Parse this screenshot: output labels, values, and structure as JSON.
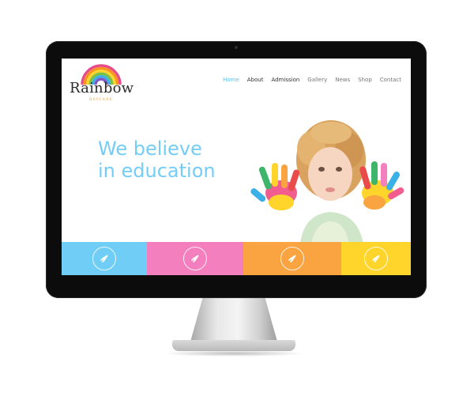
{
  "site": {
    "brand": "Rainbow",
    "brand_sub": "DAYCARE",
    "nav": [
      "Home",
      "About",
      "Admission",
      "Gallery",
      "News",
      "Shop",
      "Contact"
    ],
    "hero_line1": "We believe",
    "hero_line2": "in education"
  },
  "colors": {
    "accent": "#5bc4f2",
    "hero_text": "#74cdf6",
    "bar_blue": "#6fcdf6",
    "bar_pink": "#f47fbf",
    "bar_orange": "#f9a341",
    "bar_yellow": "#ffd52c"
  },
  "feature_bars": [
    {
      "icon": "rocket-icon",
      "color": "#6fcdf6"
    },
    {
      "icon": "rocket-icon",
      "color": "#f47fbf"
    },
    {
      "icon": "rocket-icon",
      "color": "#f9a341"
    },
    {
      "icon": "rocket-icon",
      "color": "#ffd52c"
    }
  ]
}
